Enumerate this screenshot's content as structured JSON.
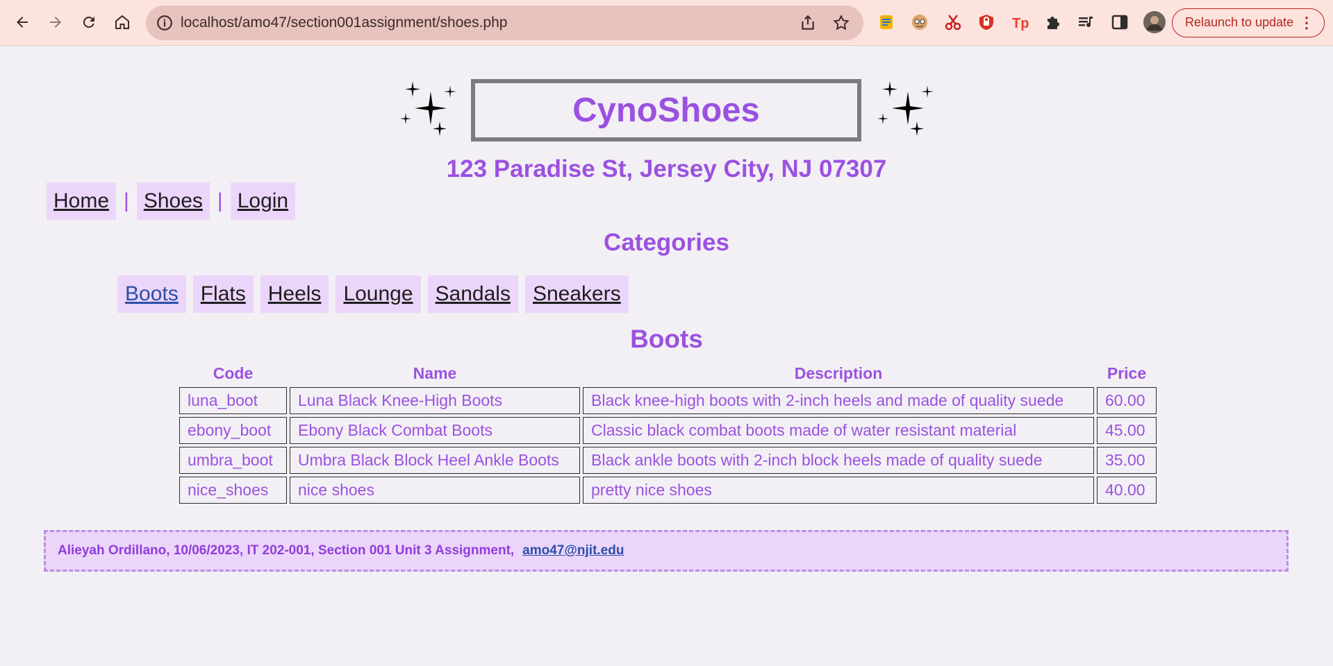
{
  "browser": {
    "url": "localhost/amo47/section001assignment/shoes.php",
    "relaunch_label": "Relaunch to update"
  },
  "site": {
    "title": "CynoShoes",
    "address": "123 Paradise St, Jersey City, NJ 07307"
  },
  "nav": {
    "items": [
      {
        "label": "Home"
      },
      {
        "label": "Shoes"
      },
      {
        "label": "Login"
      }
    ],
    "separator": "|"
  },
  "categories": {
    "heading": "Categories",
    "items": [
      "Boots",
      "Flats",
      "Heels",
      "Lounge",
      "Sandals",
      "Sneakers"
    ],
    "active": "Boots"
  },
  "section": {
    "heading": "Boots"
  },
  "table": {
    "headers": [
      "Code",
      "Name",
      "Description",
      "Price"
    ],
    "rows": [
      {
        "code": "luna_boot",
        "name": "Luna Black Knee-High Boots",
        "description": "Black knee-high boots with 2-inch heels and made of quality suede",
        "price": "60.00"
      },
      {
        "code": "ebony_boot",
        "name": "Ebony Black Combat Boots",
        "description": "Classic black combat boots made of water resistant material",
        "price": "45.00"
      },
      {
        "code": "umbra_boot",
        "name": "Umbra Black Block Heel Ankle Boots",
        "description": "Black ankle boots with 2-inch block heels made of quality suede",
        "price": "35.00"
      },
      {
        "code": "nice_shoes",
        "name": "nice shoes",
        "description": "pretty nice shoes",
        "price": "40.00"
      }
    ]
  },
  "footer": {
    "text": "Alieyah Ordillano, 10/06/2023, IT 202-001, Section 001 Unit 3 Assignment,",
    "email": "amo47@njit.edu"
  },
  "colors": {
    "accent": "#9b51e0",
    "nav_bg": "#ecd5fa",
    "page_bg": "#f3f0f5",
    "chrome_bg": "#fde3dd"
  }
}
